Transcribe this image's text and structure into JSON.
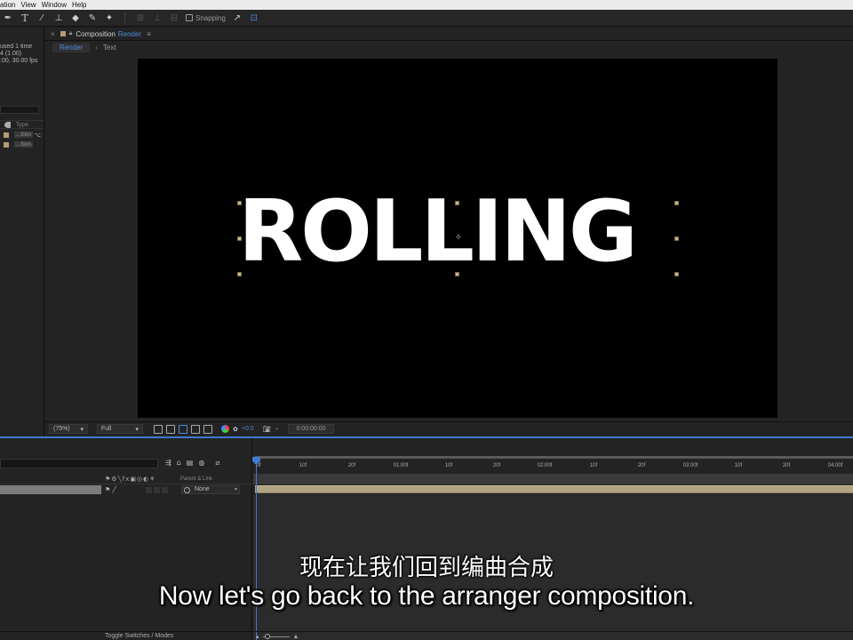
{
  "menubar": {
    "items": [
      "ation",
      "View",
      "Window",
      "Help"
    ]
  },
  "toolbar": {
    "tools": [
      "pen-tool-icon",
      "type-tool-icon",
      "brush-tool-icon",
      "clone-stamp-icon",
      "eraser-icon",
      "roto-brush-icon",
      "puppet-pin-icon"
    ],
    "snapping_label": "Snapping"
  },
  "project": {
    "info_lines": [
      "used 1 time",
      "4 (1.00)",
      ":00, 30.00 fps"
    ],
    "column_type": "Type",
    "items": [
      {
        "name": "...tion",
        "has_flow": true
      },
      {
        "name": "...tion",
        "has_flow": false
      }
    ]
  },
  "composition": {
    "tab_prefix": "Composition",
    "tab_name": "Render",
    "breadcrumbs": [
      "Render",
      "Text"
    ],
    "viewer_text": "ROLLING",
    "zoom": "(75%)",
    "resolution": "Full",
    "exposure": "+0.0",
    "timecode": "0:00:00:00"
  },
  "timeline": {
    "header_switches": "Parent & Link",
    "layer_parent": "None",
    "ruler_labels": [
      "0f",
      "10f",
      "20f",
      "01:00f",
      "10f",
      "20f",
      "02:00f",
      "10f",
      "20f",
      "03:00f",
      "10f",
      "20f",
      "04:00f"
    ],
    "bottom_toggle": "Toggle Switches / Modes"
  },
  "subtitles": {
    "zh": "现在让我们回到编曲合成",
    "en": "Now let's go back to the arranger composition."
  },
  "colors": {
    "accent": "#3d7ad0",
    "layer_track": "#b0a283",
    "label_swatch": "#b59a72"
  }
}
